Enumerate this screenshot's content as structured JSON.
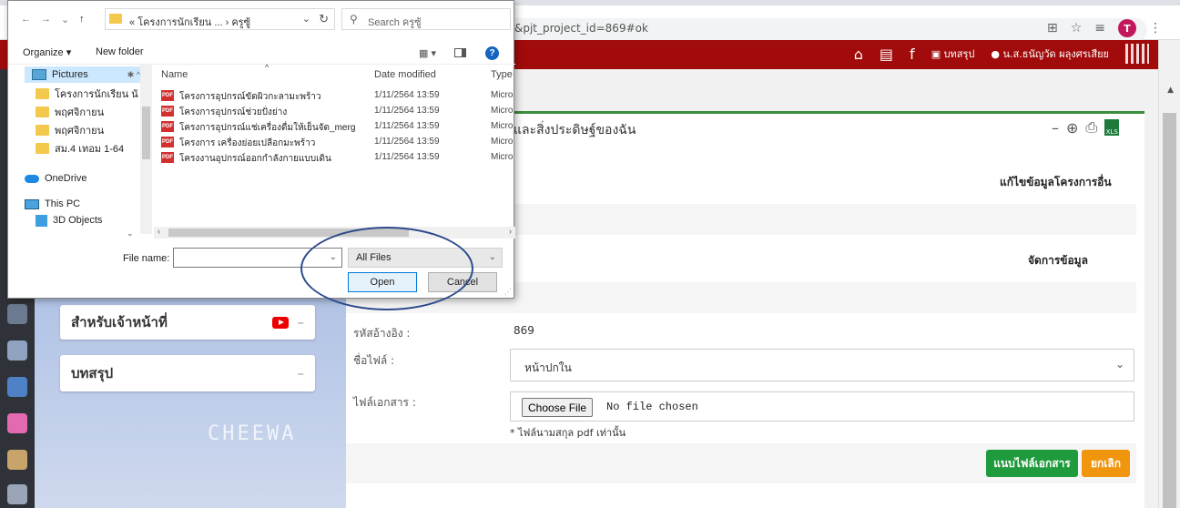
{
  "browser": {
    "url": "&pjt_project_id=869#ok",
    "avatar_letter": "T"
  },
  "site_header": {
    "summary_label": "บทสรุป",
    "user_name": "น.ส.ธนัญวัด ผลุงศรเสียย"
  },
  "dialog": {
    "breadcrumb_prefix": "«",
    "breadcrumb_folder": "โครงการนักเรียน ...",
    "breadcrumb_sep": "›",
    "breadcrumb_current": "ครูซู้",
    "search_placeholder": "Search ครูซู้",
    "organize_label": "Organize ▾",
    "new_folder_label": "New folder",
    "columns": {
      "name": "Name",
      "date": "Date modified",
      "type": "Type"
    },
    "tree": [
      {
        "label": "Pictures",
        "kind": "pictures"
      },
      {
        "label": "โครงการนักเรียน นั",
        "kind": "folder"
      },
      {
        "label": "พฤศจิกายน",
        "kind": "folder"
      },
      {
        "label": "พฤศจิกายน",
        "kind": "folder"
      },
      {
        "label": "สม.4 เทอม 1-64",
        "kind": "folder"
      },
      {
        "label": "OneDrive",
        "kind": "onedrive"
      },
      {
        "label": "This PC",
        "kind": "pc"
      },
      {
        "label": "3D Objects",
        "kind": "3d"
      }
    ],
    "files": [
      {
        "name": "โครงการอุปกรณ์ขัดผิวกะลามะพร้าว",
        "date": "1/11/2564 13:59",
        "type": "Micro"
      },
      {
        "name": "โครงการอุปกรณ์ช่วยปั่งย่าง",
        "date": "1/11/2564 13:59",
        "type": "Micro"
      },
      {
        "name": "โครงการอุปกรณ์แช่เครื่องดื่มให้เย็นจัด_merg",
        "date": "1/11/2564 13:59",
        "type": "Micro"
      },
      {
        "name": "โครงการ เครื่องย่อยเปลือกมะพร้าว",
        "date": "1/11/2564 13:59",
        "type": "Micro"
      },
      {
        "name": "โครงงานอุปกรณ์ออกกำลังกายแบบเดิน",
        "date": "1/11/2564 13:59",
        "type": "Micro"
      }
    ],
    "file_name_label": "File name:",
    "file_name_value": "",
    "file_type_value": "All Files",
    "open_label": "Open",
    "cancel_label": "Cancel"
  },
  "sidebar": {
    "card_staff": "สำหรับเจ้าหน้าที่",
    "card_summary": "บทสรุป",
    "collapse_symbol": "–",
    "watermark": "CHEEWA"
  },
  "panel": {
    "title": "และสิ่งประดิษฐ์ของฉัน",
    "tools_minus": "–",
    "edit_other": "แก้ไขข้อมูลโครงการอื่น",
    "manage_data": "จัดการข้อมูล"
  },
  "form": {
    "ref_label": "รหัสอ้างอิง :",
    "ref_value": "869",
    "filename_label": "ชื่อไฟล์ :",
    "filename_value": "หน้าปกใน",
    "doc_label": "ไฟล์เอกสาร :",
    "choose_file": "Choose File",
    "no_file": "No file chosen",
    "hint": "* ไฟล์นามสกุล pdf เท่านั้น",
    "attach_button": "แนบไฟล์เอกสาร",
    "cancel_button": "ยกเลิก"
  },
  "colors": {
    "header_red": "#a10b0b",
    "panel_green": "#3c8d3c",
    "attach_green": "#1f9a3c",
    "cancel_orange": "#f0960e",
    "annotation_blue": "#2d4a8c"
  }
}
